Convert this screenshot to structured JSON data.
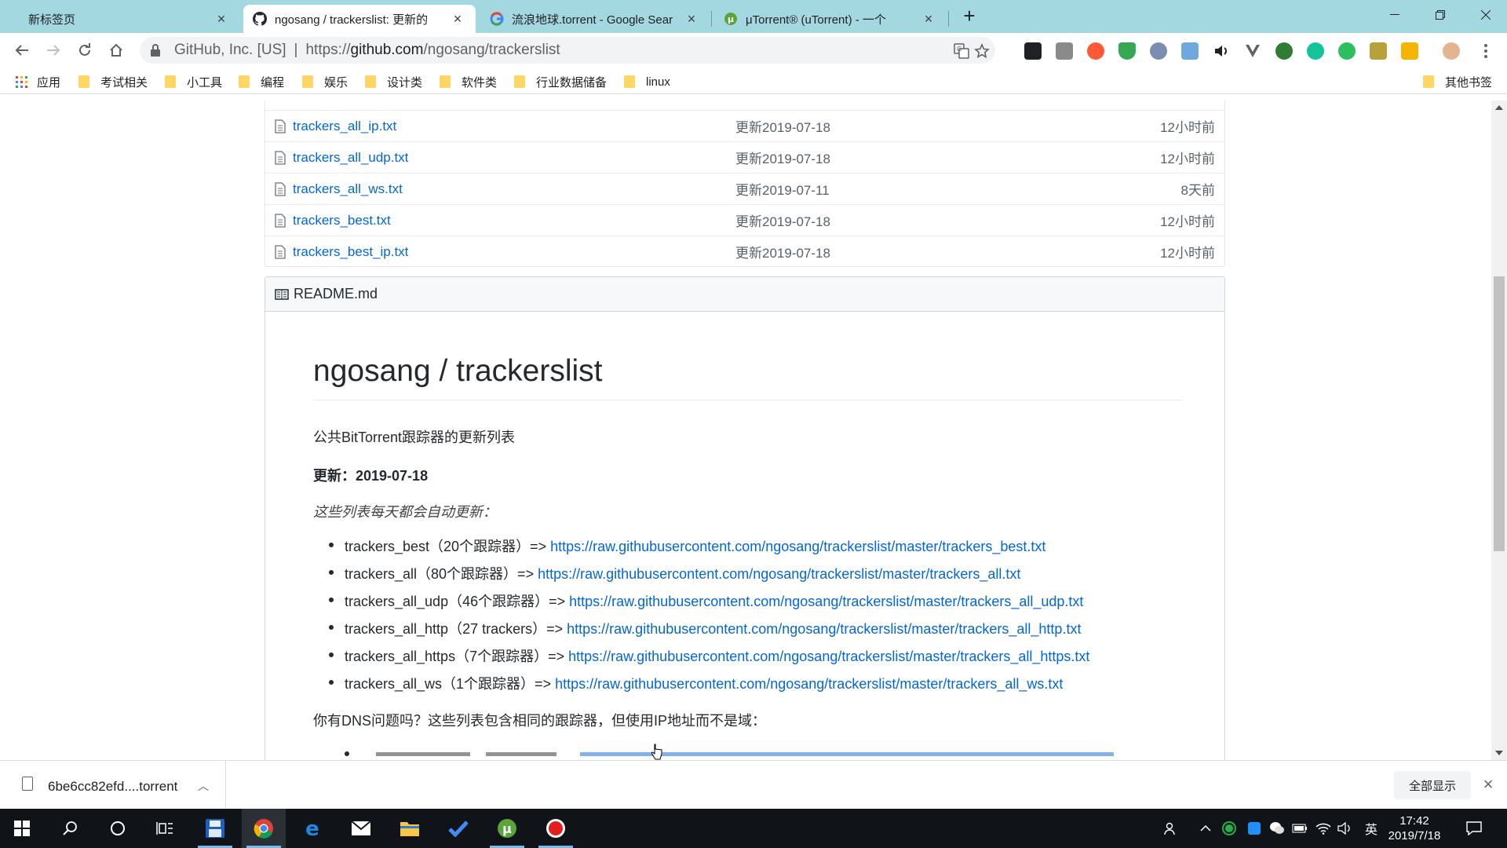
{
  "tabs": [
    {
      "title": "新标签页",
      "active": false
    },
    {
      "title": "ngosang / trackerslist: 更新的",
      "active": true
    },
    {
      "title": "流浪地球.torrent - Google Sear",
      "active": false
    },
    {
      "title": "μTorrent® (uTorrent) - 一个",
      "active": false
    }
  ],
  "toolbar": {
    "site_identity": "GitHub, Inc. [US]",
    "url_prefix": "https://",
    "url_host": "github.com",
    "url_path": "/ngosang/trackerslist"
  },
  "bookmarks": {
    "apps_label": "应用",
    "folders": [
      "考试相关",
      "小工具",
      "编程",
      "娱乐",
      "设计类",
      "软件类",
      "行业数据储备",
      "linux"
    ],
    "other": "其他书签"
  },
  "files": [
    {
      "name": "trackers_all_ip.txt",
      "message": "更新2019-07-18",
      "age": "12小时前"
    },
    {
      "name": "trackers_all_udp.txt",
      "message": "更新2019-07-18",
      "age": "12小时前"
    },
    {
      "name": "trackers_all_ws.txt",
      "message": "更新2019-07-11",
      "age": "8天前"
    },
    {
      "name": "trackers_best.txt",
      "message": "更新2019-07-18",
      "age": "12小时前"
    },
    {
      "name": "trackers_best_ip.txt",
      "message": "更新2019-07-18",
      "age": "12小时前"
    }
  ],
  "readme": {
    "filename": "README.md",
    "title": "ngosang / trackerslist",
    "tagline": "公共BitTorrent跟踪器的更新列表",
    "updated_label": "更新：",
    "updated_date": "2019-07-18",
    "daily_note": "这些列表每天都会自动更新：",
    "lists": [
      {
        "name": "trackers_best",
        "desc": "（20个跟踪器）=> ",
        "url": "https://raw.githubusercontent.com/ngosang/trackerslist/master/trackers_best.txt"
      },
      {
        "name": "trackers_all",
        "desc": "（80个跟踪器）=> ",
        "url": "https://raw.githubusercontent.com/ngosang/trackerslist/master/trackers_all.txt"
      },
      {
        "name": "trackers_all_udp",
        "desc": "（46个跟踪器）=> ",
        "url": "https://raw.githubusercontent.com/ngosang/trackerslist/master/trackers_all_udp.txt"
      },
      {
        "name": "trackers_all_http",
        "desc": "（27 trackers）=> ",
        "url": "https://raw.githubusercontent.com/ngosang/trackerslist/master/trackers_all_http.txt"
      },
      {
        "name": "trackers_all_https",
        "desc": "（7个跟踪器）=> ",
        "url": "https://raw.githubusercontent.com/ngosang/trackerslist/master/trackers_all_https.txt"
      },
      {
        "name": "trackers_all_ws",
        "desc": "（1个跟踪器）=> ",
        "url": "https://raw.githubusercontent.com/ngosang/trackerslist/master/trackers_all_ws.txt"
      }
    ],
    "dns_question": "你有DNS问题吗？这些列表包含相同的跟踪器，但使用IP地址而不是域："
  },
  "download": {
    "filename": "6be6cc82efd....torrent",
    "show_all": "全部显示"
  },
  "taskbar": {
    "ime": "英",
    "time": "17:42",
    "date": "2019/7/18"
  },
  "colors": {
    "tab_strip": "#a4d8e1",
    "link": "#0366d6",
    "taskbar": "#101418"
  }
}
